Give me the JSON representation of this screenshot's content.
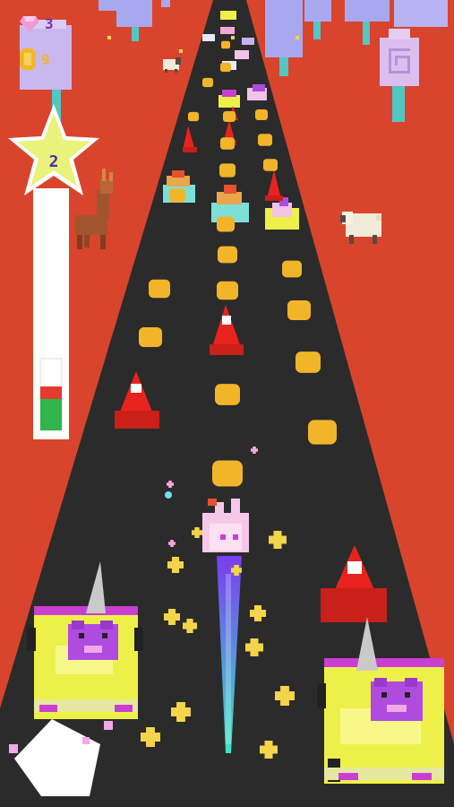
{
  "hud": {
    "gems": {
      "icon": "gem-icon",
      "value": "3"
    },
    "coins": {
      "icon": "coin-icon",
      "value": "9"
    },
    "level": {
      "icon": "star-icon",
      "value": "2"
    },
    "boost": {
      "icon": "boost-meter",
      "fill": 0.55
    }
  },
  "colors": {
    "ground": "#d9442c",
    "road": "#2b2b2b",
    "coin": "#f2b52a",
    "cone": "#e8231e",
    "car_body": "#eef04a",
    "car_trim": "#c93fd1",
    "rider": "#b04be0",
    "player_trail_top": "#7a3cf0",
    "player_trail_bottom": "#39e6c7",
    "star": "#e9f27a",
    "meter_fill": "#2fb54a",
    "meter_cap": "#e23b2f"
  }
}
